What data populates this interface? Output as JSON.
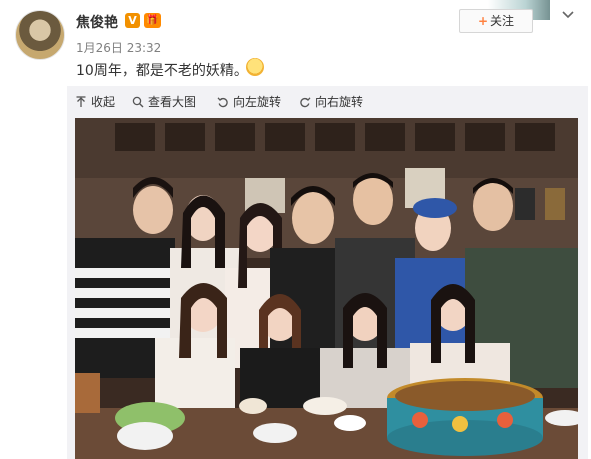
{
  "post": {
    "username": "焦俊艳",
    "verified_badge": "V",
    "member_badge": "🎁",
    "timestamp": "1月26日 23:32",
    "text": "10周年，都是不老的妖精。",
    "emoji_icon": "grinning-emoji-icon"
  },
  "header": {
    "follow_plus": "+",
    "follow_label": "关注",
    "chevron_icon": "chevron-down-icon"
  },
  "toolbar": {
    "collapse_label": "收起",
    "view_large_label": "查看大图",
    "rotate_left_label": "向左旋转",
    "rotate_right_label": "向右旋转"
  },
  "photo": {
    "description_icon": "group-photo-image"
  },
  "colors": {
    "accent_orange": "#ff8140",
    "panel_bg": "#f2f2f5",
    "text": "#333333",
    "muted": "#808080"
  }
}
